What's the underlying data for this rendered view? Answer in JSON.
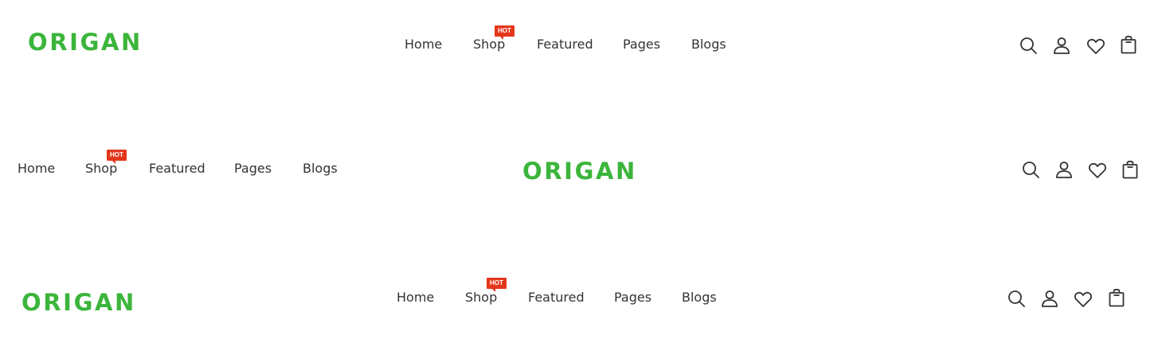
{
  "brand": {
    "logo_text": "ORIGAN",
    "accent_color": "#3bb53b",
    "hot_color": "#e4361b",
    "text_color": "#333333"
  },
  "nav": {
    "home": "Home",
    "shop": "Shop",
    "shop_badge": "HOT",
    "featured": "Featured",
    "pages": "Pages",
    "blogs": "Blogs"
  },
  "icons": [
    "search-icon",
    "user-icon",
    "heart-icon",
    "shopping-bag-icon"
  ]
}
